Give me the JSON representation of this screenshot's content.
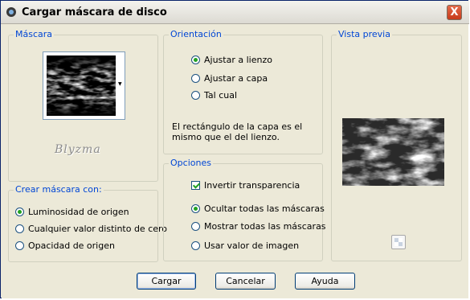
{
  "window": {
    "title": "Cargar máscara de disco",
    "close_label": "X"
  },
  "mascara": {
    "label": "Máscara",
    "brand": "Blyzma"
  },
  "crear": {
    "label": "Crear máscara con:",
    "options": [
      "Luminosidad de origen",
      "Cualquier valor distinto de cero",
      "Opacidad de origen"
    ],
    "selected": "Luminosidad de origen"
  },
  "orientacion": {
    "label": "Orientación",
    "options": [
      "Ajustar a lienzo",
      "Ajustar a capa",
      "Tal cual"
    ],
    "selected": "Ajustar a lienzo",
    "description": "El rectángulo de la capa es el mismo que el del lienzo."
  },
  "opciones": {
    "label": "Opciones",
    "invert_label": "Invertir transparencia",
    "invert_checked": true,
    "options": [
      "Ocultar todas las máscaras",
      "Mostrar todas las máscaras",
      "Usar valor de imagen"
    ],
    "selected": "Ocultar todas las máscaras"
  },
  "vista_previa": {
    "label": "Vista previa"
  },
  "buttons": {
    "ok": "Cargar",
    "cancel": "Cancelar",
    "help": "Ayuda"
  },
  "colors": {
    "accent": "#0046D5",
    "title_bar": "#ECE9D8",
    "close": "#D4502E",
    "check": "#21A121"
  }
}
